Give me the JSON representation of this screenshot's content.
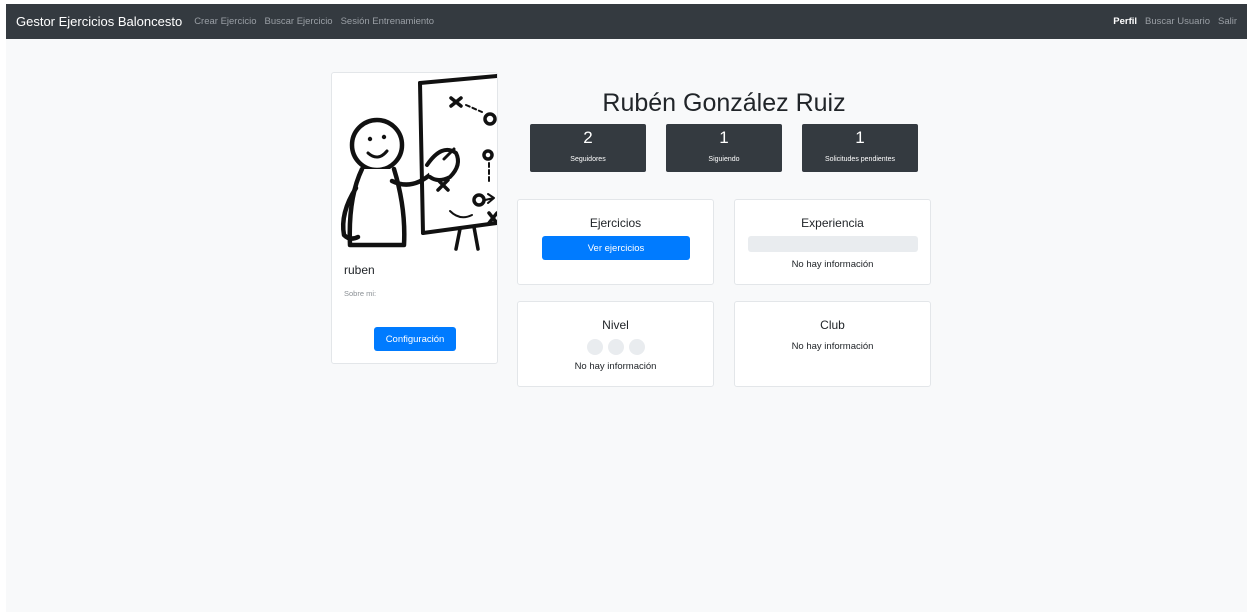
{
  "navbar": {
    "brand": "Gestor Ejercicios Baloncesto",
    "links": [
      "Crear Ejercicio",
      "Buscar Ejercicio",
      "Sesión Entrenamiento"
    ],
    "right_links": [
      "Perfil",
      "Buscar Usuario",
      "Salir"
    ],
    "active": "Perfil"
  },
  "profile": {
    "username": "ruben",
    "about_label": "Sobre mi:",
    "config_button": "Configuración",
    "full_name": "Rubén González Ruiz"
  },
  "stats": [
    {
      "value": "2",
      "label": "Seguidores"
    },
    {
      "value": "1",
      "label": "Siguiendo"
    },
    {
      "value": "1",
      "label": "Solicitudes pendientes"
    }
  ],
  "cards": {
    "ejercicios": {
      "title": "Ejercicios",
      "button": "Ver ejercicios"
    },
    "experiencia": {
      "title": "Experiencia",
      "text": "No hay información"
    },
    "nivel": {
      "title": "Nivel",
      "text": "No hay información",
      "level": 0,
      "max_level": 3
    },
    "club": {
      "title": "Club",
      "text": "No hay información"
    }
  },
  "icons": {
    "avatar": "coach-whiteboard-illustration"
  },
  "colors": {
    "navbar": "#343a40",
    "primary": "#007bff",
    "stat_bg": "#343a40"
  }
}
